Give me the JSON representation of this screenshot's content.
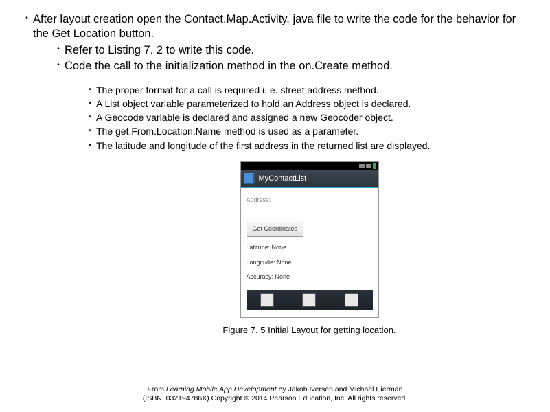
{
  "bullets": {
    "lvl1_a": "After layout creation open the Contact.Map.Activity. java file to write the code for the behavior for the Get Location button.",
    "lvl2_a": "Refer to  Listing  7. 2 to write this code.",
    "lvl2_b": "Code the call to the initialization method in the on.Create method.",
    "lvl3_a": "The proper format for a call is required i. e. street address method.",
    "lvl3_b": "A List object variable parameterized to hold an  Address object is declared.",
    "lvl3_c": "A Geocode variable is declared and assigned a new Geocoder object.",
    "lvl3_d": "The get.From.Location.Name method is used as a parameter.",
    "lvl3_e": "The latitude and longitude of the first address in the returned list are displayed."
  },
  "phone": {
    "app_title": "MyContactList",
    "address_label": "Address:",
    "button": "Get Coordinates",
    "lat": "Latitude:  None",
    "lon": "Longitude:  None",
    "acc": "Accuracy:  None"
  },
  "caption": "Figure 7. 5   Initial Layout for getting location.",
  "footer": {
    "line1_prefix": "From ",
    "line1_title": "Learning Mobile App Development",
    "line1_suffix": " by Jakob Iversen and Michael Eierman",
    "line2": "(ISBN: 032194786X) Copyright © 2014 Pearson Education, Inc. All rights reserved."
  }
}
